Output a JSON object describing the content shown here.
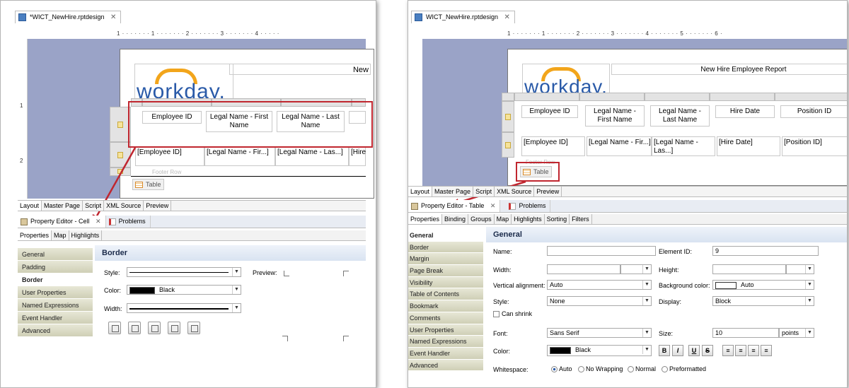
{
  "left": {
    "tab_title": "*WICT_NewHire.rptdesign",
    "ruler_text": "1 · · · · · · · 1 · · · · · · · 2 · · · · · · · 3 · · · · · · · 4 · · · · ·",
    "vruler": [
      "1",
      "2"
    ],
    "report_title": "New",
    "logo_text": "workday.",
    "headers": [
      "Employee ID",
      "Legal Name - First Name",
      "Legal Name - Last Name"
    ],
    "data_cells": [
      "[Employee ID]",
      "[Legal Name - Fir...]",
      "[Legal Name - Las...]",
      "[Hire"
    ],
    "footer_row": "Footer Row",
    "table_button": "Table",
    "layout_tabs": [
      "Layout",
      "Master Page",
      "Script",
      "XML Source",
      "Preview"
    ],
    "view_tabs": [
      "Property Editor - Cell",
      "Problems"
    ],
    "sub_tabs": [
      "Properties",
      "Map",
      "Highlights"
    ],
    "categories": [
      "General",
      "Padding",
      "Border",
      "User Properties",
      "Named Expressions",
      "Event Handler",
      "Advanced"
    ],
    "active_category": "Border",
    "section_title": "Border",
    "style_label": "Style:",
    "preview_label": "Preview:",
    "color_label": "Color:",
    "color_value": "Black",
    "width_label": "Width:"
  },
  "right": {
    "tab_title": "WICT_NewHire.rptdesign",
    "ruler_text": "1 · · · · · · · 1 · · · · · · · 2 · · · · · · · 3 · · · · · · · 4 · · · · · · · 5 · · · · · · · 6 ·",
    "report_title": "New Hire Employee Report",
    "logo_text": "workday.",
    "headers": [
      "Employee ID",
      "Legal Name - First Name",
      "Legal Name - Last Name",
      "Hire Date",
      "Position ID"
    ],
    "data_cells": [
      "[Employee ID]",
      "[Legal Name - Fir...]",
      "[Legal Name - Las...]",
      "[Hire Date]",
      "[Position ID]"
    ],
    "footer_row": "Footer Row",
    "table_button": "Table",
    "layout_tabs": [
      "Layout",
      "Master Page",
      "Script",
      "XML Source",
      "Preview"
    ],
    "view_tabs": [
      "Property Editor - Table",
      "Problems"
    ],
    "sub_tabs": [
      "Properties",
      "Binding",
      "Groups",
      "Map",
      "Highlights",
      "Sorting",
      "Filters"
    ],
    "categories": [
      "General",
      "Border",
      "Margin",
      "Page Break",
      "Visibility",
      "Table of Contents",
      "Bookmark",
      "Comments",
      "User Properties",
      "Named Expressions",
      "Event Handler",
      "Advanced"
    ],
    "active_category": "General",
    "section_title": "General",
    "fields": {
      "name_label": "Name:",
      "name_value": "",
      "element_id_label": "Element ID:",
      "element_id_value": "9",
      "width_label": "Width:",
      "height_label": "Height:",
      "valign_label": "Vertical alignment:",
      "valign_value": "Auto",
      "bgcolor_label": "Background color:",
      "bgcolor_value": "Auto",
      "style_label": "Style:",
      "style_value": "None",
      "display_label": "Display:",
      "display_value": "Block",
      "can_shrink": "Can shrink",
      "font_label": "Font:",
      "font_value": "Sans Serif",
      "size_label": "Size:",
      "size_value": "10",
      "size_unit": "points",
      "color_label": "Color:",
      "color_value": "Black",
      "whitespace_label": "Whitespace:",
      "whitespace_options": [
        "Auto",
        "No Wrapping",
        "Normal",
        "Preformatted"
      ]
    },
    "format_buttons": [
      "B",
      "I",
      "U",
      "S"
    ]
  },
  "colors": {
    "highlight": "#c0262f",
    "canvas": "#9aa3c7",
    "logo": "#2a5aa8",
    "logo_arc": "#f2a51b"
  }
}
